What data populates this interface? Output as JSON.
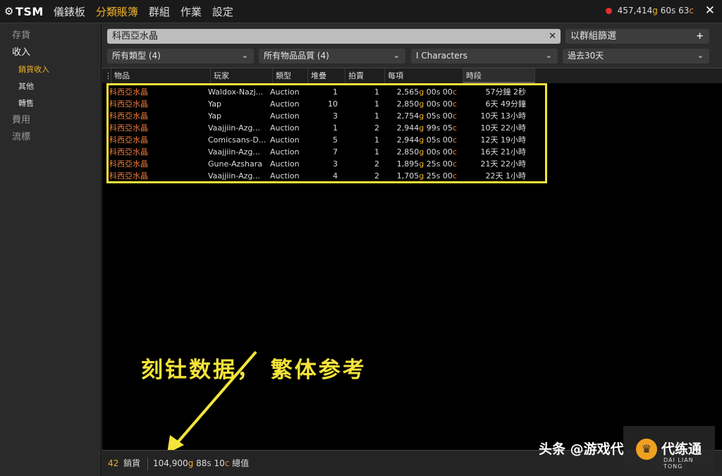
{
  "topbar": {
    "logo": "TSM",
    "nav": [
      "儀錶板",
      "分類賬簿",
      "群組",
      "作業",
      "設定"
    ],
    "active_nav": "分類賬簿",
    "gold": {
      "g": "457,414",
      "s": "60",
      "c": "63"
    }
  },
  "sidebar": {
    "items": [
      "存貨",
      "收入",
      "費用",
      "流標"
    ],
    "income_sub": [
      "銷貨收入",
      "其他",
      "轉售"
    ]
  },
  "filters": {
    "search_value": "科西亞水晶",
    "group_button": "以群組篩選",
    "type": "所有類型 (4)",
    "quality": "所有物品品質 (4)",
    "characters": "I Characters",
    "period": "過去30天"
  },
  "table": {
    "columns": [
      "物品",
      "玩家",
      "類型",
      "堆疊",
      "拍賣",
      "每項",
      "時段"
    ],
    "rows": [
      {
        "item": "科西亞水晶",
        "player": "Waldox-Nazj...",
        "type": "Auction",
        "stack": "1",
        "auctions": "1",
        "g": "2,565",
        "s": "00",
        "c": "00",
        "time": "57分鐘 2秒"
      },
      {
        "item": "科西亞水晶",
        "player": "Yap",
        "type": "Auction",
        "stack": "10",
        "auctions": "1",
        "g": "2,850",
        "s": "00",
        "c": "00",
        "time": "6天 49分鐘"
      },
      {
        "item": "科西亞水晶",
        "player": "Yap",
        "type": "Auction",
        "stack": "3",
        "auctions": "1",
        "g": "2,754",
        "s": "05",
        "c": "00",
        "time": "10天 13小時"
      },
      {
        "item": "科西亞水晶",
        "player": "Vaajjiin-Azg...",
        "type": "Auction",
        "stack": "1",
        "auctions": "2",
        "g": "2,944",
        "s": "99",
        "c": "05",
        "time": "10天 22小時"
      },
      {
        "item": "科西亞水晶",
        "player": "Comicsans-D...",
        "type": "Auction",
        "stack": "5",
        "auctions": "1",
        "g": "2,944",
        "s": "05",
        "c": "00",
        "time": "12天 19小時"
      },
      {
        "item": "科西亞水晶",
        "player": "Vaajjiin-Azg...",
        "type": "Auction",
        "stack": "7",
        "auctions": "1",
        "g": "2,850",
        "s": "00",
        "c": "00",
        "time": "16天 21小時"
      },
      {
        "item": "科西亞水晶",
        "player": "Gune-Azshara",
        "type": "Auction",
        "stack": "3",
        "auctions": "2",
        "g": "1,895",
        "s": "25",
        "c": "00",
        "time": "21天 22小時"
      },
      {
        "item": "科西亞水晶",
        "player": "Vaajjiin-Azg...",
        "type": "Auction",
        "stack": "4",
        "auctions": "2",
        "g": "1,705",
        "s": "25",
        "c": "00",
        "time": "22天 1小時"
      }
    ]
  },
  "annotation": "刻钍数据， 繁体参考",
  "footer": {
    "count": "42",
    "count_label": "銷貨",
    "total_g": "104,900",
    "total_s": "88",
    "total_c": "10",
    "total_label": "總值"
  },
  "watermark": {
    "text": "头条 @游戏代",
    "brand": "代练通",
    "brand_en": "DAI LIAN TONG"
  },
  "colors": {
    "gold": "#f0b429",
    "item_orange": "#f07a3a",
    "highlight": "#f5e43a"
  }
}
